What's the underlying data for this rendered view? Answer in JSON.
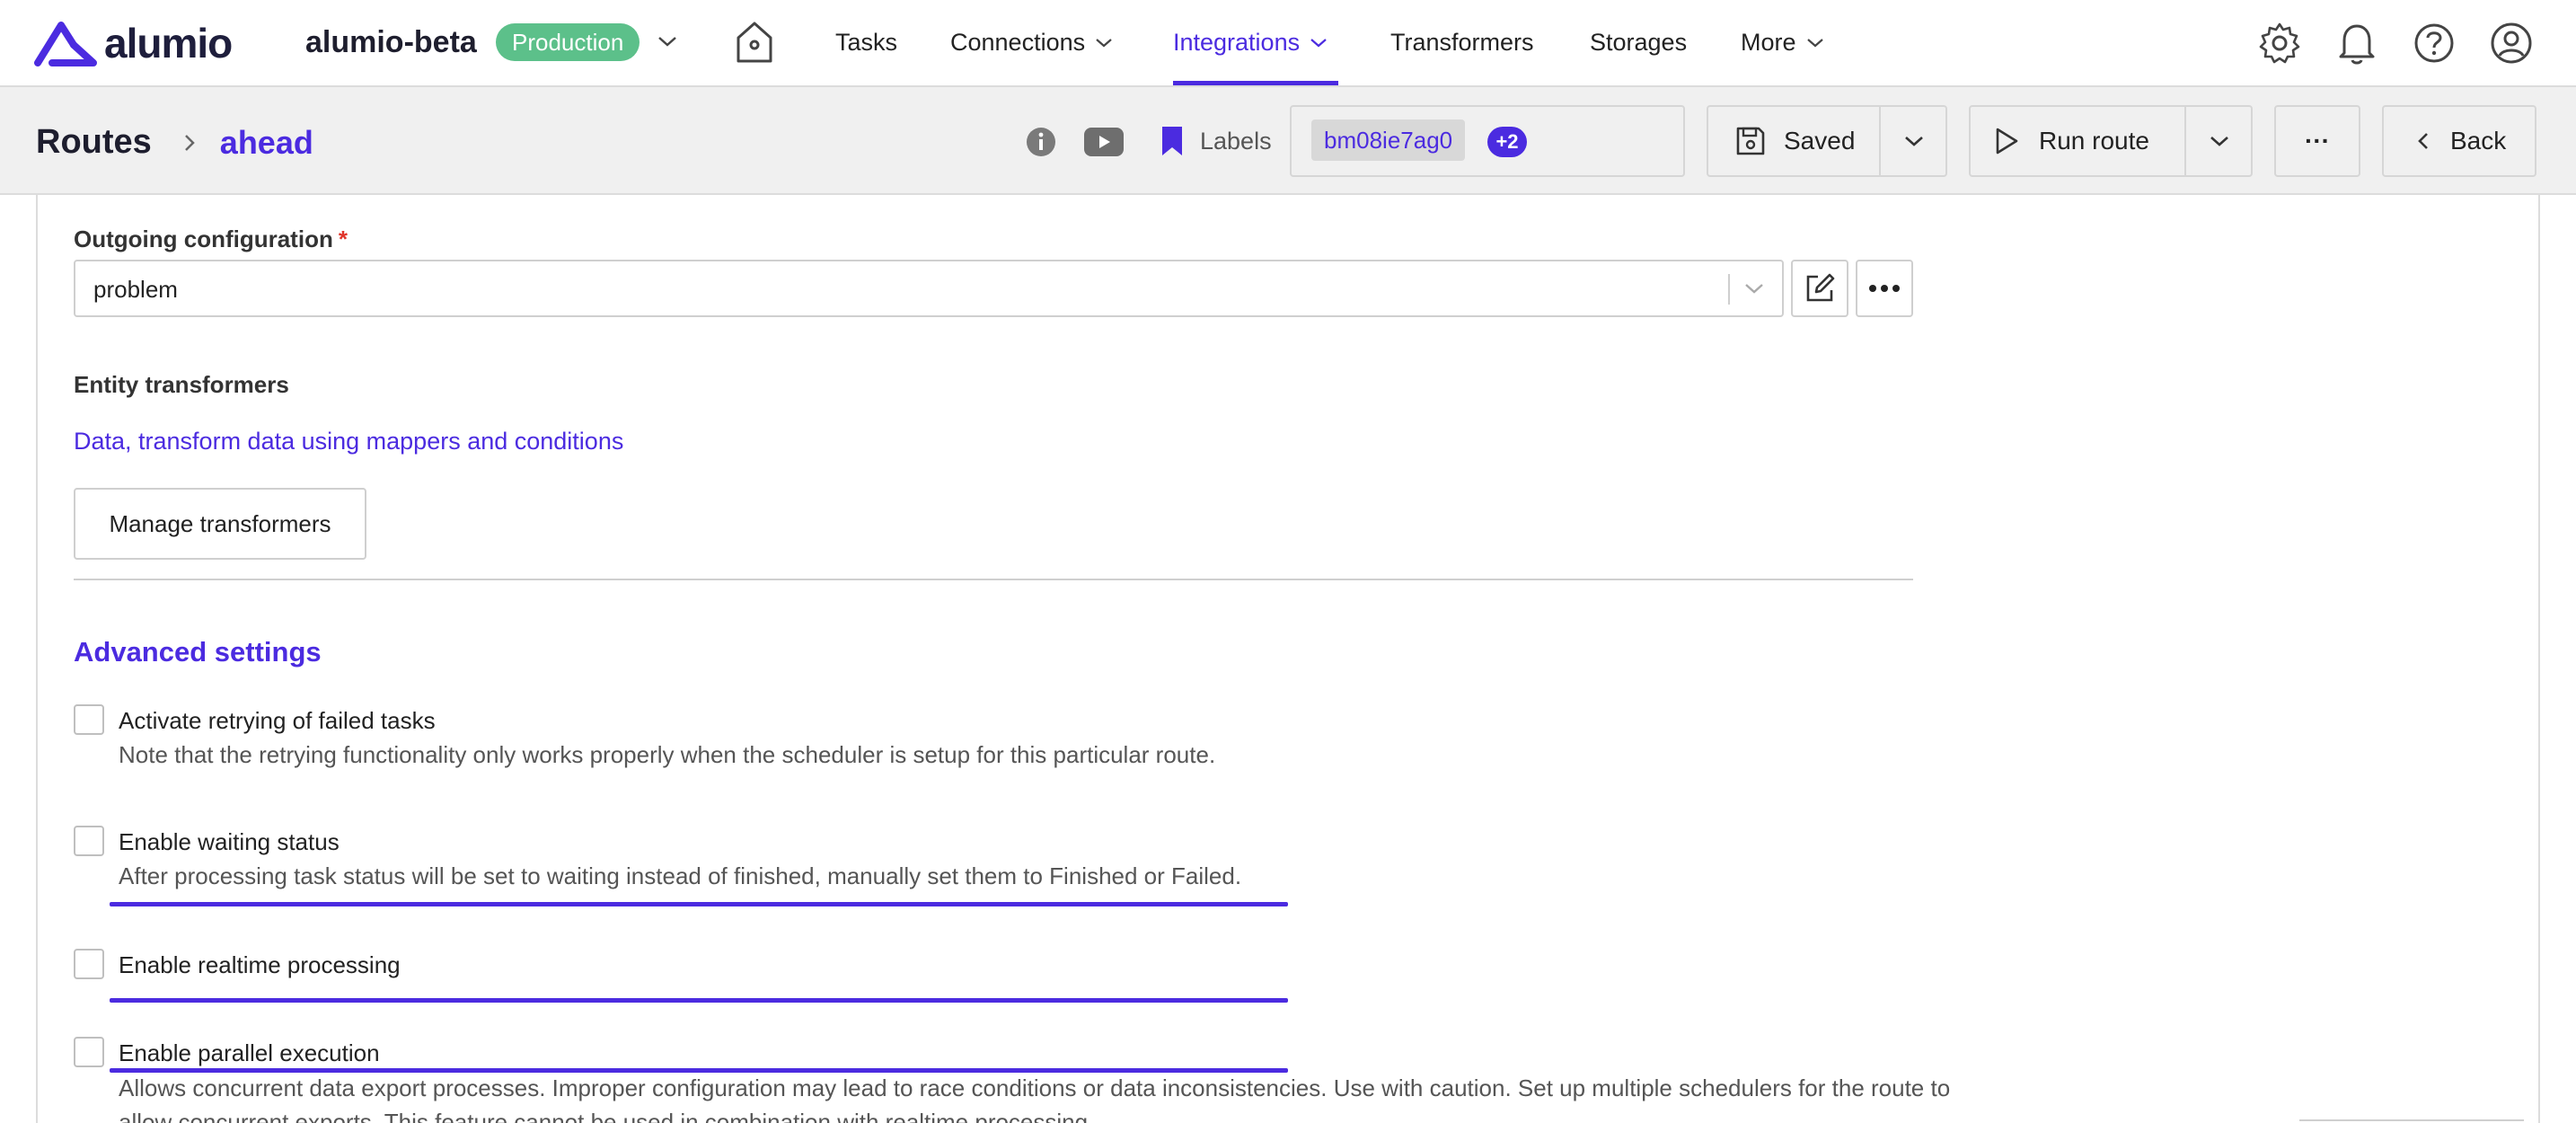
{
  "brand": {
    "logo_text": "alumio",
    "workspace": "alumio-beta",
    "environment": "Production"
  },
  "nav": {
    "items": [
      {
        "label": "Tasks"
      },
      {
        "label": "Connections"
      },
      {
        "label": "Integrations"
      },
      {
        "label": "Transformers"
      },
      {
        "label": "Storages"
      },
      {
        "label": "More"
      }
    ],
    "active": "Integrations"
  },
  "breadcrumb": {
    "root": "Routes",
    "current": "ahead"
  },
  "labels": {
    "title": "Labels",
    "chip": "bm08ie7ag0",
    "extra_count": "+2"
  },
  "actions": {
    "saved": "Saved",
    "run": "Run route",
    "more": "···",
    "back": "Back"
  },
  "form": {
    "outgoing": {
      "label": "Outgoing configuration",
      "required_mark": "*",
      "value": "problem"
    },
    "entity_transformers": {
      "label": "Entity transformers",
      "link": "Data, transform data using mappers and conditions",
      "button": "Manage transformers"
    },
    "advanced": {
      "title": "Advanced settings",
      "options": [
        {
          "label": "Activate retrying of failed tasks",
          "description": "Note that the retrying functionality only works properly when the scheduler is setup for this particular route.",
          "checked": false
        },
        {
          "label": "Enable waiting status",
          "description": "After processing task status will be set to waiting instead of finished, manually set them to Finished or Failed.",
          "checked": false
        },
        {
          "label": "Enable realtime processing",
          "description": "",
          "checked": false
        },
        {
          "label": "Enable parallel execution",
          "description": "Allows concurrent data export processes. Improper configuration may lead to race conditions or data inconsistencies. Use with caution. Set up multiple schedulers for the route to allow concurrent exports. This feature cannot be used in combination with realtime processing.",
          "checked": false
        }
      ]
    }
  },
  "colors": {
    "accent": "#4b2be0",
    "production": "#5cc08a",
    "required": "#e0342a"
  }
}
